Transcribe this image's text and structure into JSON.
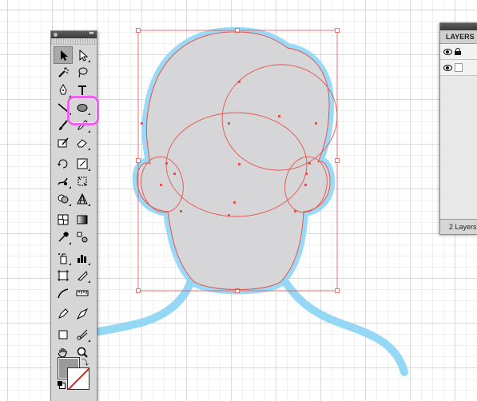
{
  "layers_panel": {
    "tab_title": "LAYERS",
    "footer_text": "2 Layers"
  },
  "tools_panel": {
    "selected_tool": "ellipse-tool",
    "fill_color": "#9a9a9a",
    "stroke_color": "none"
  },
  "colors": {
    "selection_stroke": "#e8534f",
    "sketch_stroke": "#8fd6f6",
    "shape_fill": "#d6d6d8",
    "highlight": "#f25ef0"
  }
}
